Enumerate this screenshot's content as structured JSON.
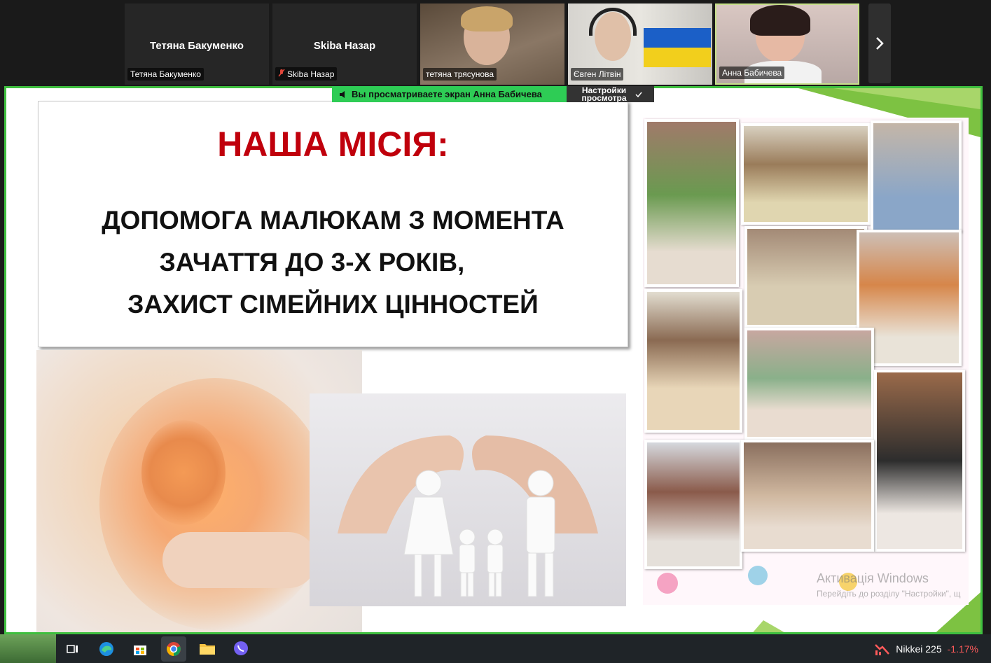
{
  "participants": [
    {
      "name": "Тетяна Бакуменко",
      "center_name": "Тетяна Бакуменко",
      "video": false,
      "muted": false
    },
    {
      "name": "Skiba Назар",
      "center_name": "Skiba Назар",
      "video": false,
      "muted": true
    },
    {
      "name": "тетяна трясунова",
      "video": true
    },
    {
      "name": "Євген Літвін",
      "video": true
    },
    {
      "name": "Анна Бабичева",
      "video": true,
      "active": true
    }
  ],
  "share_banner": {
    "text": "Вы просматриваете экран  Анна Бабичева",
    "view_settings": "Настройки просмотра"
  },
  "slide": {
    "title": "НАША МІСІЯ:",
    "mission_lines": [
      "ДОПОМОГА МАЛЮКАМ З МОМЕНТА",
      "ЗАЧАТТЯ ДО 3-Х РОКІВ,",
      "ЗАХИСТ СІМЕЙНИХ ЦІННОСТЕЙ"
    ]
  },
  "watermark": {
    "line1": "Активація Windows",
    "line2": "Перейдіть до розділу \"Настройки\", щ"
  },
  "taskbar": {
    "icons": [
      "desktop-thumbnail-icon",
      "task-view-icon",
      "edge-icon",
      "store-icon",
      "chrome-icon",
      "file-explorer-icon",
      "viber-icon"
    ],
    "ticker": {
      "name": "Nikkei 225",
      "change": "-1.17%"
    }
  },
  "colors": {
    "share_border": "#3fbf3f",
    "banner": "#2ecc55",
    "title_red": "#c0000c"
  }
}
